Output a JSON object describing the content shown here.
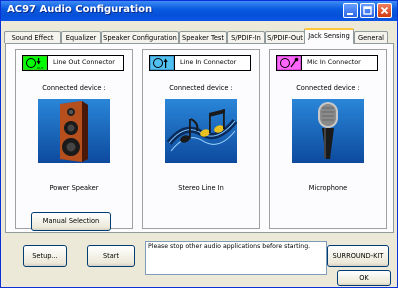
{
  "window": {
    "title": "AC97 Audio Configuration"
  },
  "tabs": [
    {
      "label": "Sound Effect"
    },
    {
      "label": "Equalizer"
    },
    {
      "label": "Speaker Configuration"
    },
    {
      "label": "Speaker Test"
    },
    {
      "label": "S/PDIF-In"
    },
    {
      "label": "S/PDIF-Out"
    },
    {
      "label": "Jack Sensing",
      "active": true
    },
    {
      "label": "General"
    }
  ],
  "connectors": [
    {
      "label": "Line Out Connector",
      "badge": "OUT",
      "icon": "line-out-jack-icon",
      "color": "#00ff00",
      "icon_border": "#6aa83a",
      "connected_label": "Connected device :",
      "device": "Power Speaker",
      "device_icon": "speaker-icon"
    },
    {
      "label": "Line In Connector",
      "icon": "line-in-jack-icon",
      "color": "#4fc0f0",
      "icon_border": "#3a7cb8",
      "connected_label": "Connected device :",
      "device": "Stereo Line In",
      "device_icon": "music-notes-icon"
    },
    {
      "label": "Mic In Connector",
      "icon": "mic-jack-icon",
      "color": "#ff66ff",
      "icon_border": "#b03ab0",
      "connected_label": "Connected device :",
      "device": "Microphone",
      "device_icon": "microphone-icon"
    }
  ],
  "buttons": {
    "manual_selection": "Manual Selection",
    "setup": "Setup...",
    "start": "Start",
    "surround_kit": "SURROUND-KIT",
    "ok": "OK"
  },
  "message": "Please stop other audio applications before starting."
}
